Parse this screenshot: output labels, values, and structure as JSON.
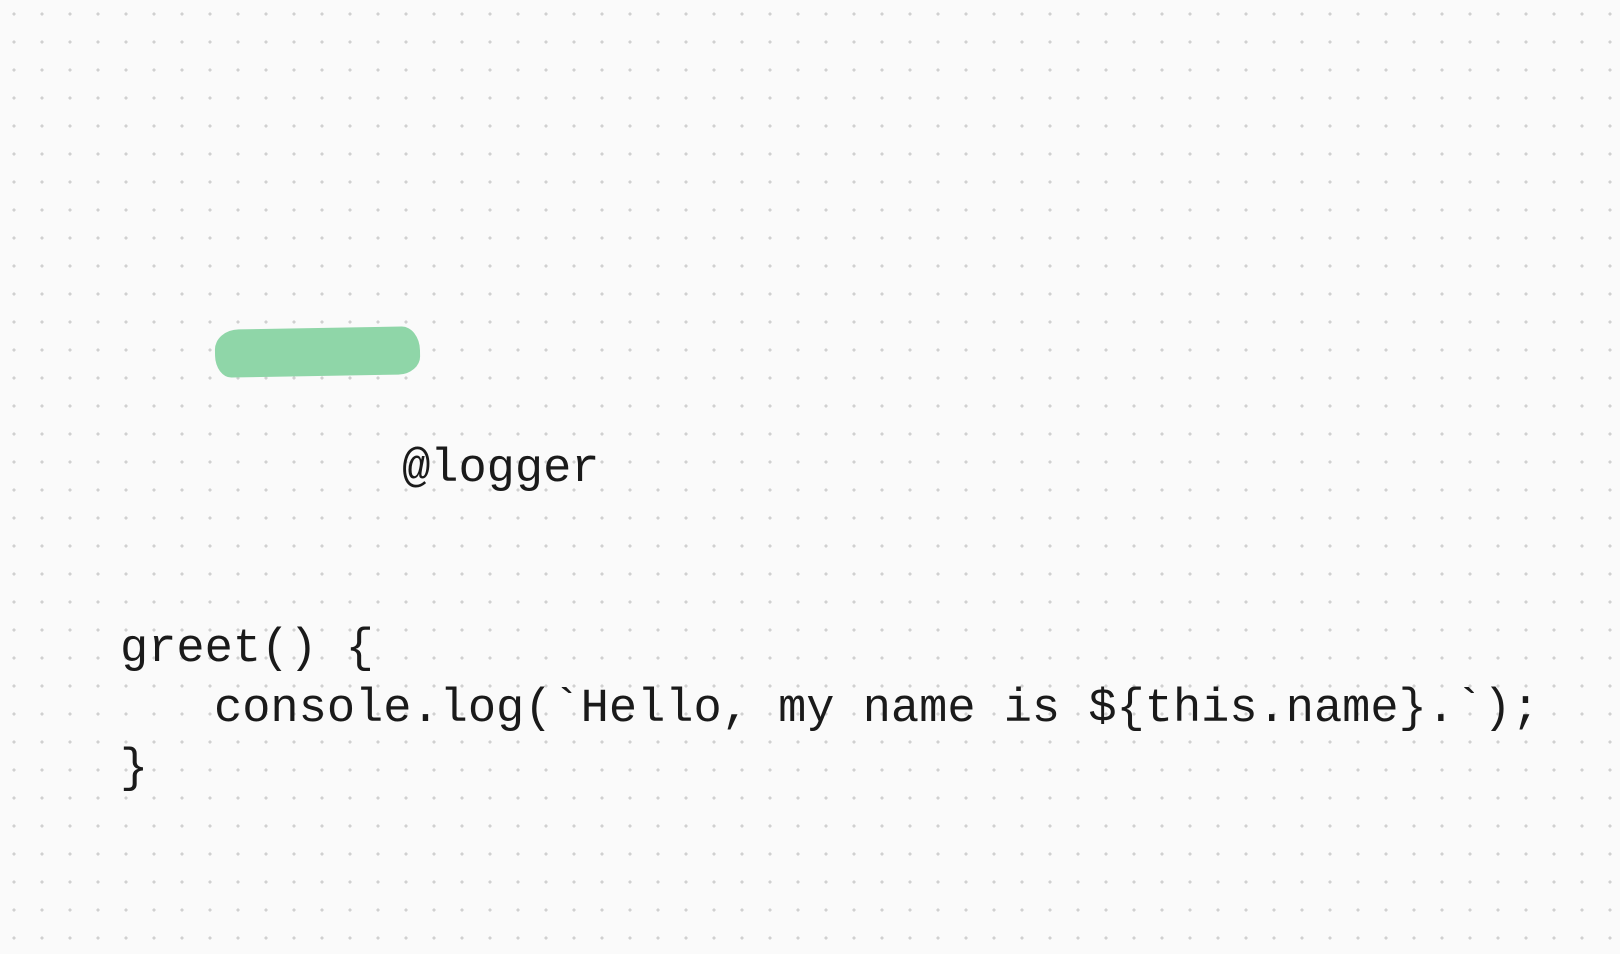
{
  "code": {
    "line1": "@logger",
    "line2": "greet() {",
    "line3": "console.log(`Hello, my name is ${this.name}.`);",
    "line4": "}"
  }
}
